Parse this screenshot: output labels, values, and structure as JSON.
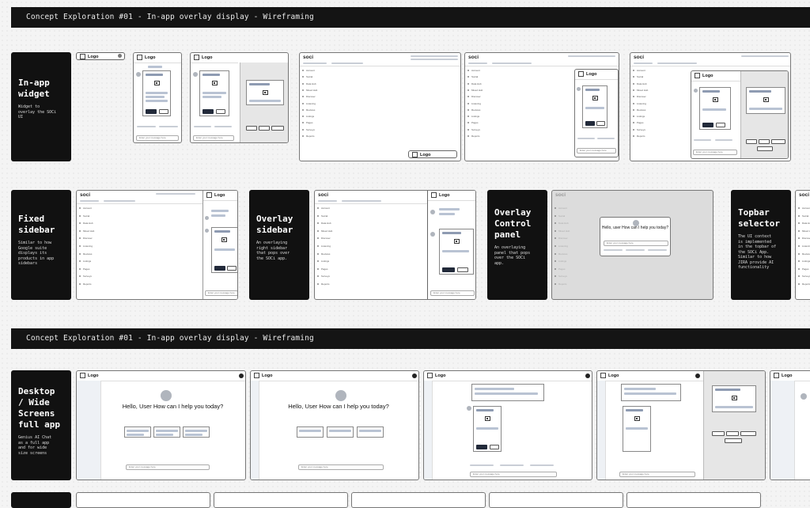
{
  "banners": [
    "Concept Exploration #01 - In-app overlay display - Wireframing",
    "Concept Exploration #01 - In-app overlay display - Wireframing"
  ],
  "sections": {
    "inapp": {
      "title": "In-app\nwidget",
      "desc": "Widget to\noverlay the SOCi\nUI"
    },
    "fixed": {
      "title": "Fixed\nsidebar",
      "desc": "Similar to how\nGoogle suite\ndisplays its\nproducts in app\nsidebars"
    },
    "overlay": {
      "title": "Overlay\nsidebar",
      "desc": "An overlaying\nright sidebar\nthat pops over\nthe SOCi app."
    },
    "control": {
      "title": "Overlay\nControl\npanel",
      "desc": "An overlaying\npanel that pops\nover the SOCi\napp."
    },
    "topbar": {
      "title": "Topbar\nselector",
      "desc": "The UI context\nis implemented\nin the topbar of\nthe SOCi App.\nSimilar to how\nJIRA provide AI\nfunctionality"
    },
    "desktop": {
      "title": "Desktop\n/ Wide\nScreens\nfull app",
      "desc": "Genius AI Chat\nas a full app\nand for wide\nsize screens"
    }
  },
  "ui": {
    "logo": "Logo",
    "brand": "soci",
    "hello_user_caps": "Hello, User\nHow can I help\nyou today?",
    "hello_user_lower": "Hello, user\nHow can I help\nyou today?",
    "message_placeholder": "Enter your message here",
    "approve": "Approve",
    "preview": "Preview"
  },
  "nav_items": [
    "Account",
    "Social",
    "Data Hub",
    "Mixed Hub",
    "Discover",
    "Listening",
    "Reviews",
    "Listings",
    "Pages",
    "Surveys",
    "Reports"
  ],
  "colors": {
    "banner": "#141414",
    "label": "#111111",
    "accent_bar": "#b9c3d3",
    "dark_bar": "#8e9bb2"
  }
}
